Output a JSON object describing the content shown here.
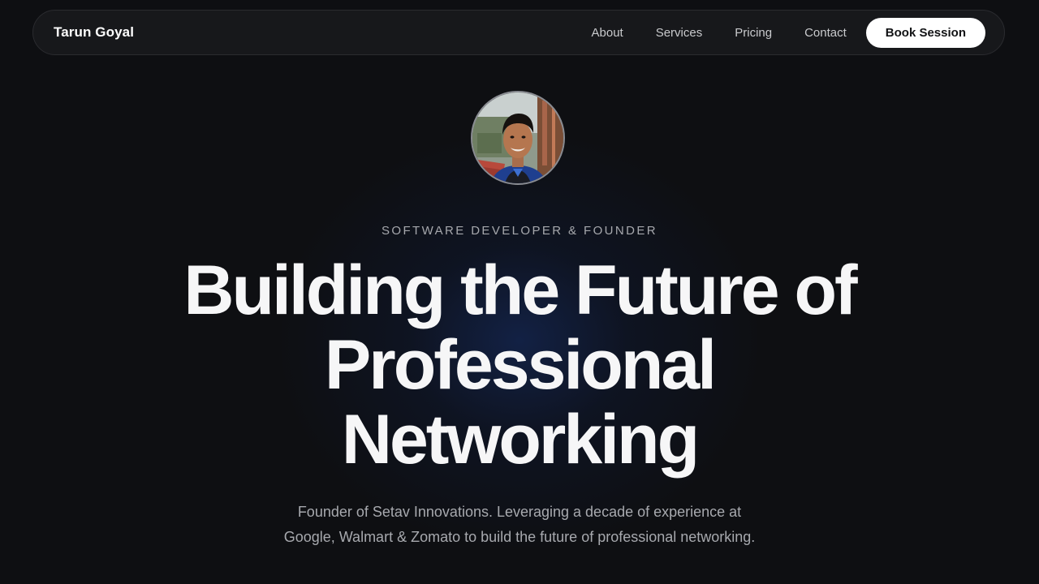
{
  "nav": {
    "brand": "Tarun Goyal",
    "links": [
      "About",
      "Services",
      "Pricing",
      "Contact"
    ],
    "cta": "Book Session"
  },
  "hero": {
    "eyebrow": "SOFTWARE DEVELOPER & FOUNDER",
    "headline_lines": [
      "Building the Future of",
      "Professional",
      "Networking"
    ],
    "description": "Founder of Setav Innovations. Leveraging a decade of experience at Google, Walmart & Zomato to build the future of professional networking."
  },
  "colors": {
    "background": "#0e0f12",
    "nav_background": "#17181b",
    "accent_glow": "#16306e",
    "button_background": "#ffffff",
    "button_text": "#111214"
  }
}
